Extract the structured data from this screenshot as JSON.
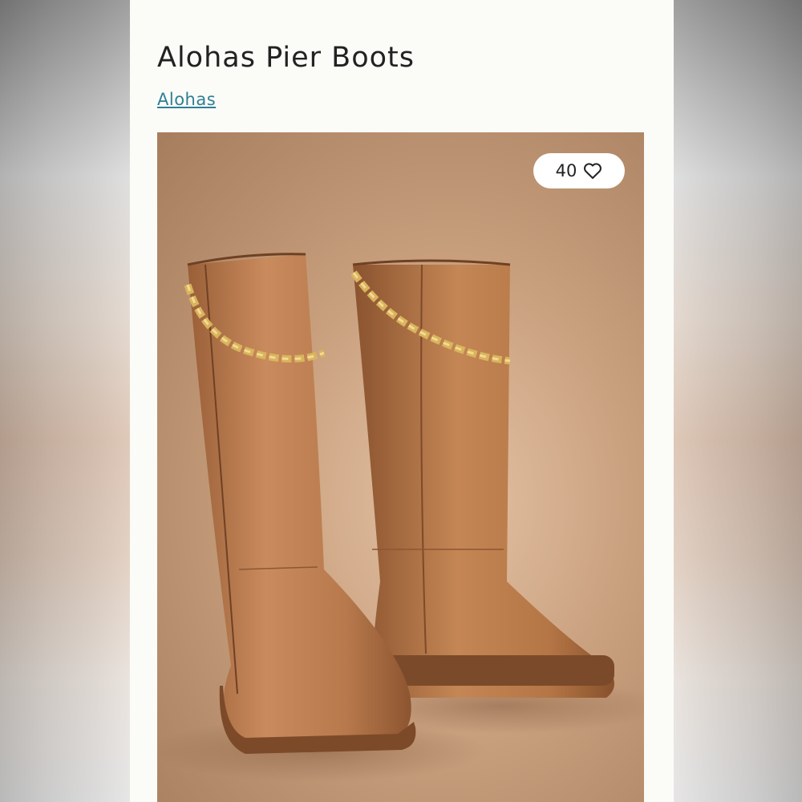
{
  "product": {
    "title": "Alohas Pier Boots",
    "brand": "Alohas"
  },
  "favorites": {
    "count": "40",
    "icon": "heart-icon"
  },
  "image": {
    "subject": "boots-photo"
  }
}
